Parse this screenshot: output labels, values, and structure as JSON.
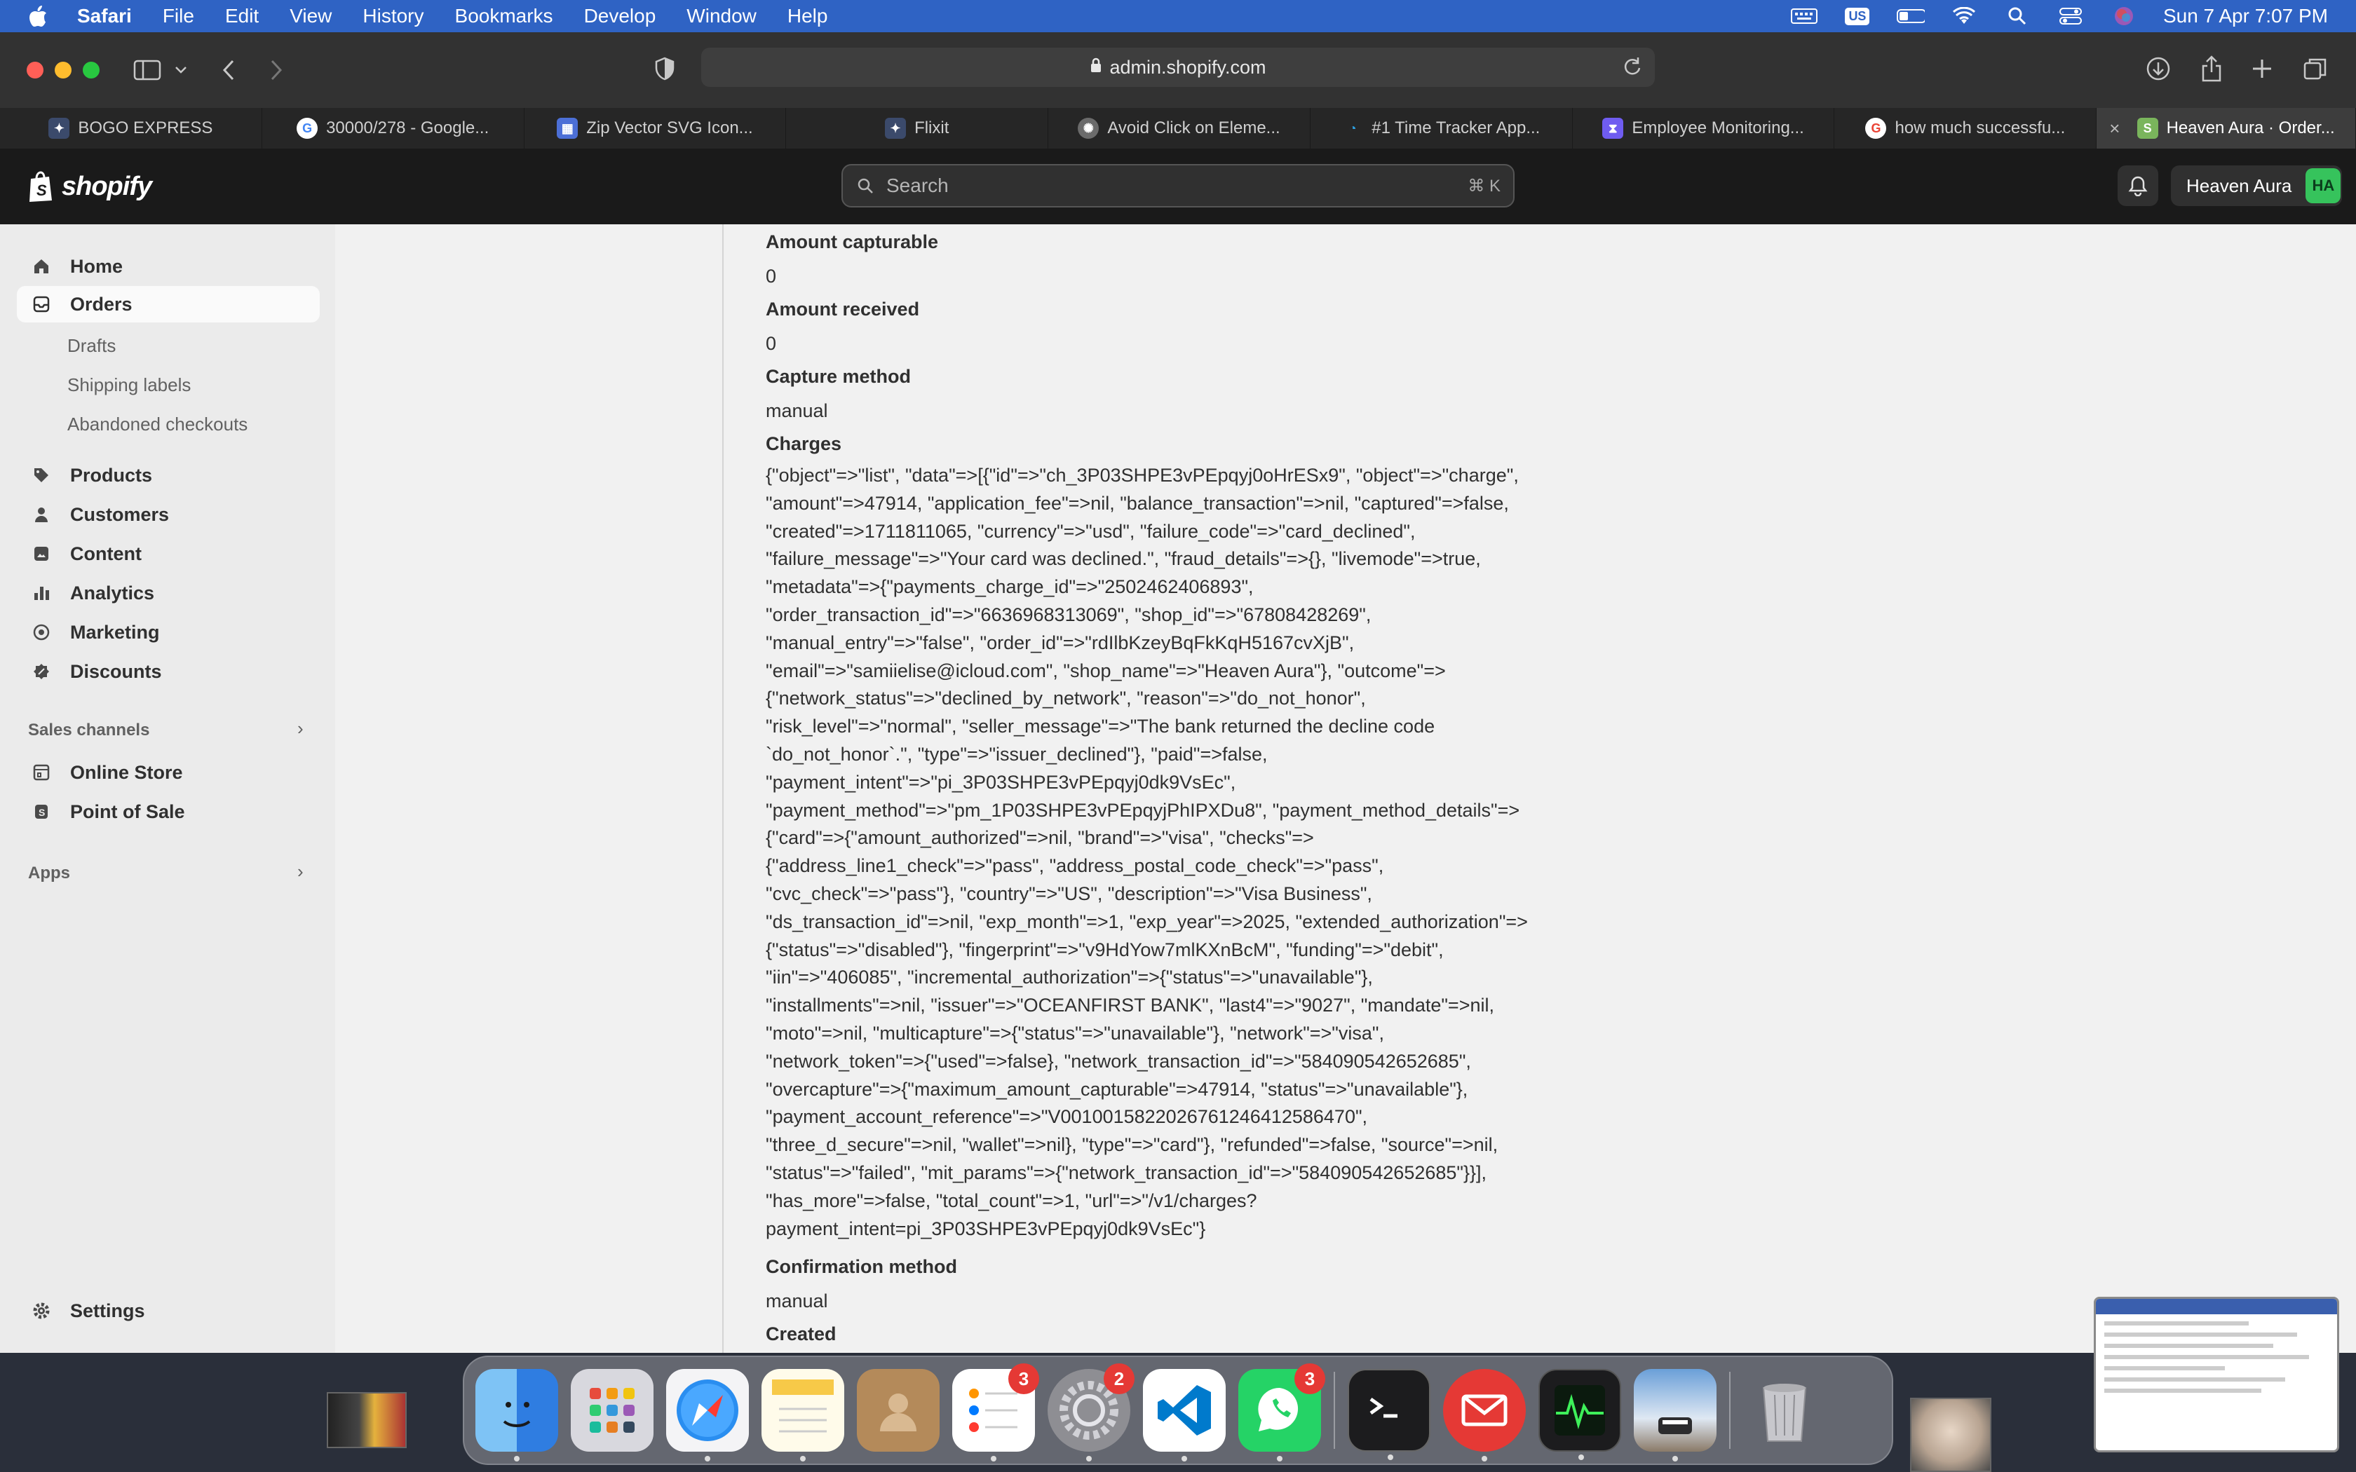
{
  "menubar": {
    "app": "Safari",
    "items": [
      "File",
      "Edit",
      "View",
      "History",
      "Bookmarks",
      "Develop",
      "Window",
      "Help"
    ],
    "datetime": "Sun 7 Apr  7:07 PM",
    "input_source": "US"
  },
  "browser": {
    "url": "admin.shopify.com",
    "tabs": [
      {
        "label": "BOGO EXPRESS",
        "fav_color": "#3b4a6b"
      },
      {
        "label": "30000/278 - Google...",
        "fav_color": "#ffffff"
      },
      {
        "label": "Zip Vector SVG Icon...",
        "fav_color": "#4c6fd6"
      },
      {
        "label": "Flixit",
        "fav_color": "#3b4a6b"
      },
      {
        "label": "Avoid Click on Eleme...",
        "fav_color": "#6b6b6b"
      },
      {
        "label": "#1 Time Tracker App...",
        "fav_color": "#2b6ea8"
      },
      {
        "label": "Employee Monitoring...",
        "fav_color": "#6f5cf0"
      },
      {
        "label": "how much successfu...",
        "fav_color": "#ffffff"
      },
      {
        "label": "Heaven Aura · Order...",
        "fav_color": "#7ab55c"
      }
    ]
  },
  "shopify": {
    "logo_text": "shopify",
    "search_placeholder": "Search",
    "search_shortcut": "⌘ K",
    "store_name": "Heaven Aura",
    "avatar_initials": "HA"
  },
  "sidebar": {
    "home": "Home",
    "orders": "Orders",
    "drafts": "Drafts",
    "shipping_labels": "Shipping labels",
    "abandoned_checkouts": "Abandoned checkouts",
    "products": "Products",
    "customers": "Customers",
    "content": "Content",
    "analytics": "Analytics",
    "marketing": "Marketing",
    "discounts": "Discounts",
    "sales_channels": "Sales channels",
    "online_store": "Online Store",
    "point_of_sale": "Point of Sale",
    "apps": "Apps",
    "settings": "Settings"
  },
  "details": {
    "amount_capturable_label": "Amount capturable",
    "amount_capturable_value": "0",
    "amount_received_label": "Amount received",
    "amount_received_value": "0",
    "capture_method_label": "Capture method",
    "capture_method_value": "manual",
    "charges_label": "Charges",
    "charges_value": "{\"object\"=>\"list\", \"data\"=>[{\"id\"=>\"ch_3P03SHPE3vPEpqyj0oHrESx9\", \"object\"=>\"charge\",\n\"amount\"=>47914, \"application_fee\"=>nil, \"balance_transaction\"=>nil, \"captured\"=>false,\n\"created\"=>1711811065, \"currency\"=>\"usd\", \"failure_code\"=>\"card_declined\",\n\"failure_message\"=>\"Your card was declined.\", \"fraud_details\"=>{}, \"livemode\"=>true,\n\"metadata\"=>{\"payments_charge_id\"=>\"2502462406893\",\n\"order_transaction_id\"=>\"6636968313069\", \"shop_id\"=>\"67808428269\",\n\"manual_entry\"=>\"false\", \"order_id\"=>\"rdIlbKzeyBqFkKqH5167cvXjB\",\n\"email\"=>\"samiielise@icloud.com\", \"shop_name\"=>\"Heaven Aura\"}, \"outcome\"=>\n{\"network_status\"=>\"declined_by_network\", \"reason\"=>\"do_not_honor\",\n\"risk_level\"=>\"normal\", \"seller_message\"=>\"The bank returned the decline code\n`do_not_honor`.\", \"type\"=>\"issuer_declined\"}, \"paid\"=>false,\n\"payment_intent\"=>\"pi_3P03SHPE3vPEpqyj0dk9VsEc\",\n\"payment_method\"=>\"pm_1P03SHPE3vPEpqyjPhIPXDu8\", \"payment_method_details\"=>\n{\"card\"=>{\"amount_authorized\"=>nil, \"brand\"=>\"visa\", \"checks\"=>\n{\"address_line1_check\"=>\"pass\", \"address_postal_code_check\"=>\"pass\",\n\"cvc_check\"=>\"pass\"}, \"country\"=>\"US\", \"description\"=>\"Visa Business\",\n\"ds_transaction_id\"=>nil, \"exp_month\"=>1, \"exp_year\"=>2025, \"extended_authorization\"=>\n{\"status\"=>\"disabled\"}, \"fingerprint\"=>\"v9HdYow7mlKXnBcM\", \"funding\"=>\"debit\",\n\"iin\"=>\"406085\", \"incremental_authorization\"=>{\"status\"=>\"unavailable\"},\n\"installments\"=>nil, \"issuer\"=>\"OCEANFIRST BANK\", \"last4\"=>\"9027\", \"mandate\"=>nil,\n\"moto\"=>nil, \"multicapture\"=>{\"status\"=>\"unavailable\"}, \"network\"=>\"visa\",\n\"network_token\"=>{\"used\"=>false}, \"network_transaction_id\"=>\"584090542652685\",\n\"overcapture\"=>{\"maximum_amount_capturable\"=>47914, \"status\"=>\"unavailable\"},\n\"payment_account_reference\"=>\"V0010015822026761246412586470\",\n\"three_d_secure\"=>nil, \"wallet\"=>nil}, \"type\"=>\"card\"}, \"refunded\"=>false, \"source\"=>nil,\n\"status\"=>\"failed\", \"mit_params\"=>{\"network_transaction_id\"=>\"584090542652685\"}}],\n\"has_more\"=>false, \"total_count\"=>1, \"url\"=>\"/v1/charges?\npayment_intent=pi_3P03SHPE3vPEpqyj0dk9VsEc\"}",
    "confirmation_method_label": "Confirmation method",
    "confirmation_method_value": "manual",
    "created_label": "Created"
  },
  "dock": {
    "reminders_badge": "3",
    "settings_badge": "2",
    "whatsapp_badge": "3"
  }
}
